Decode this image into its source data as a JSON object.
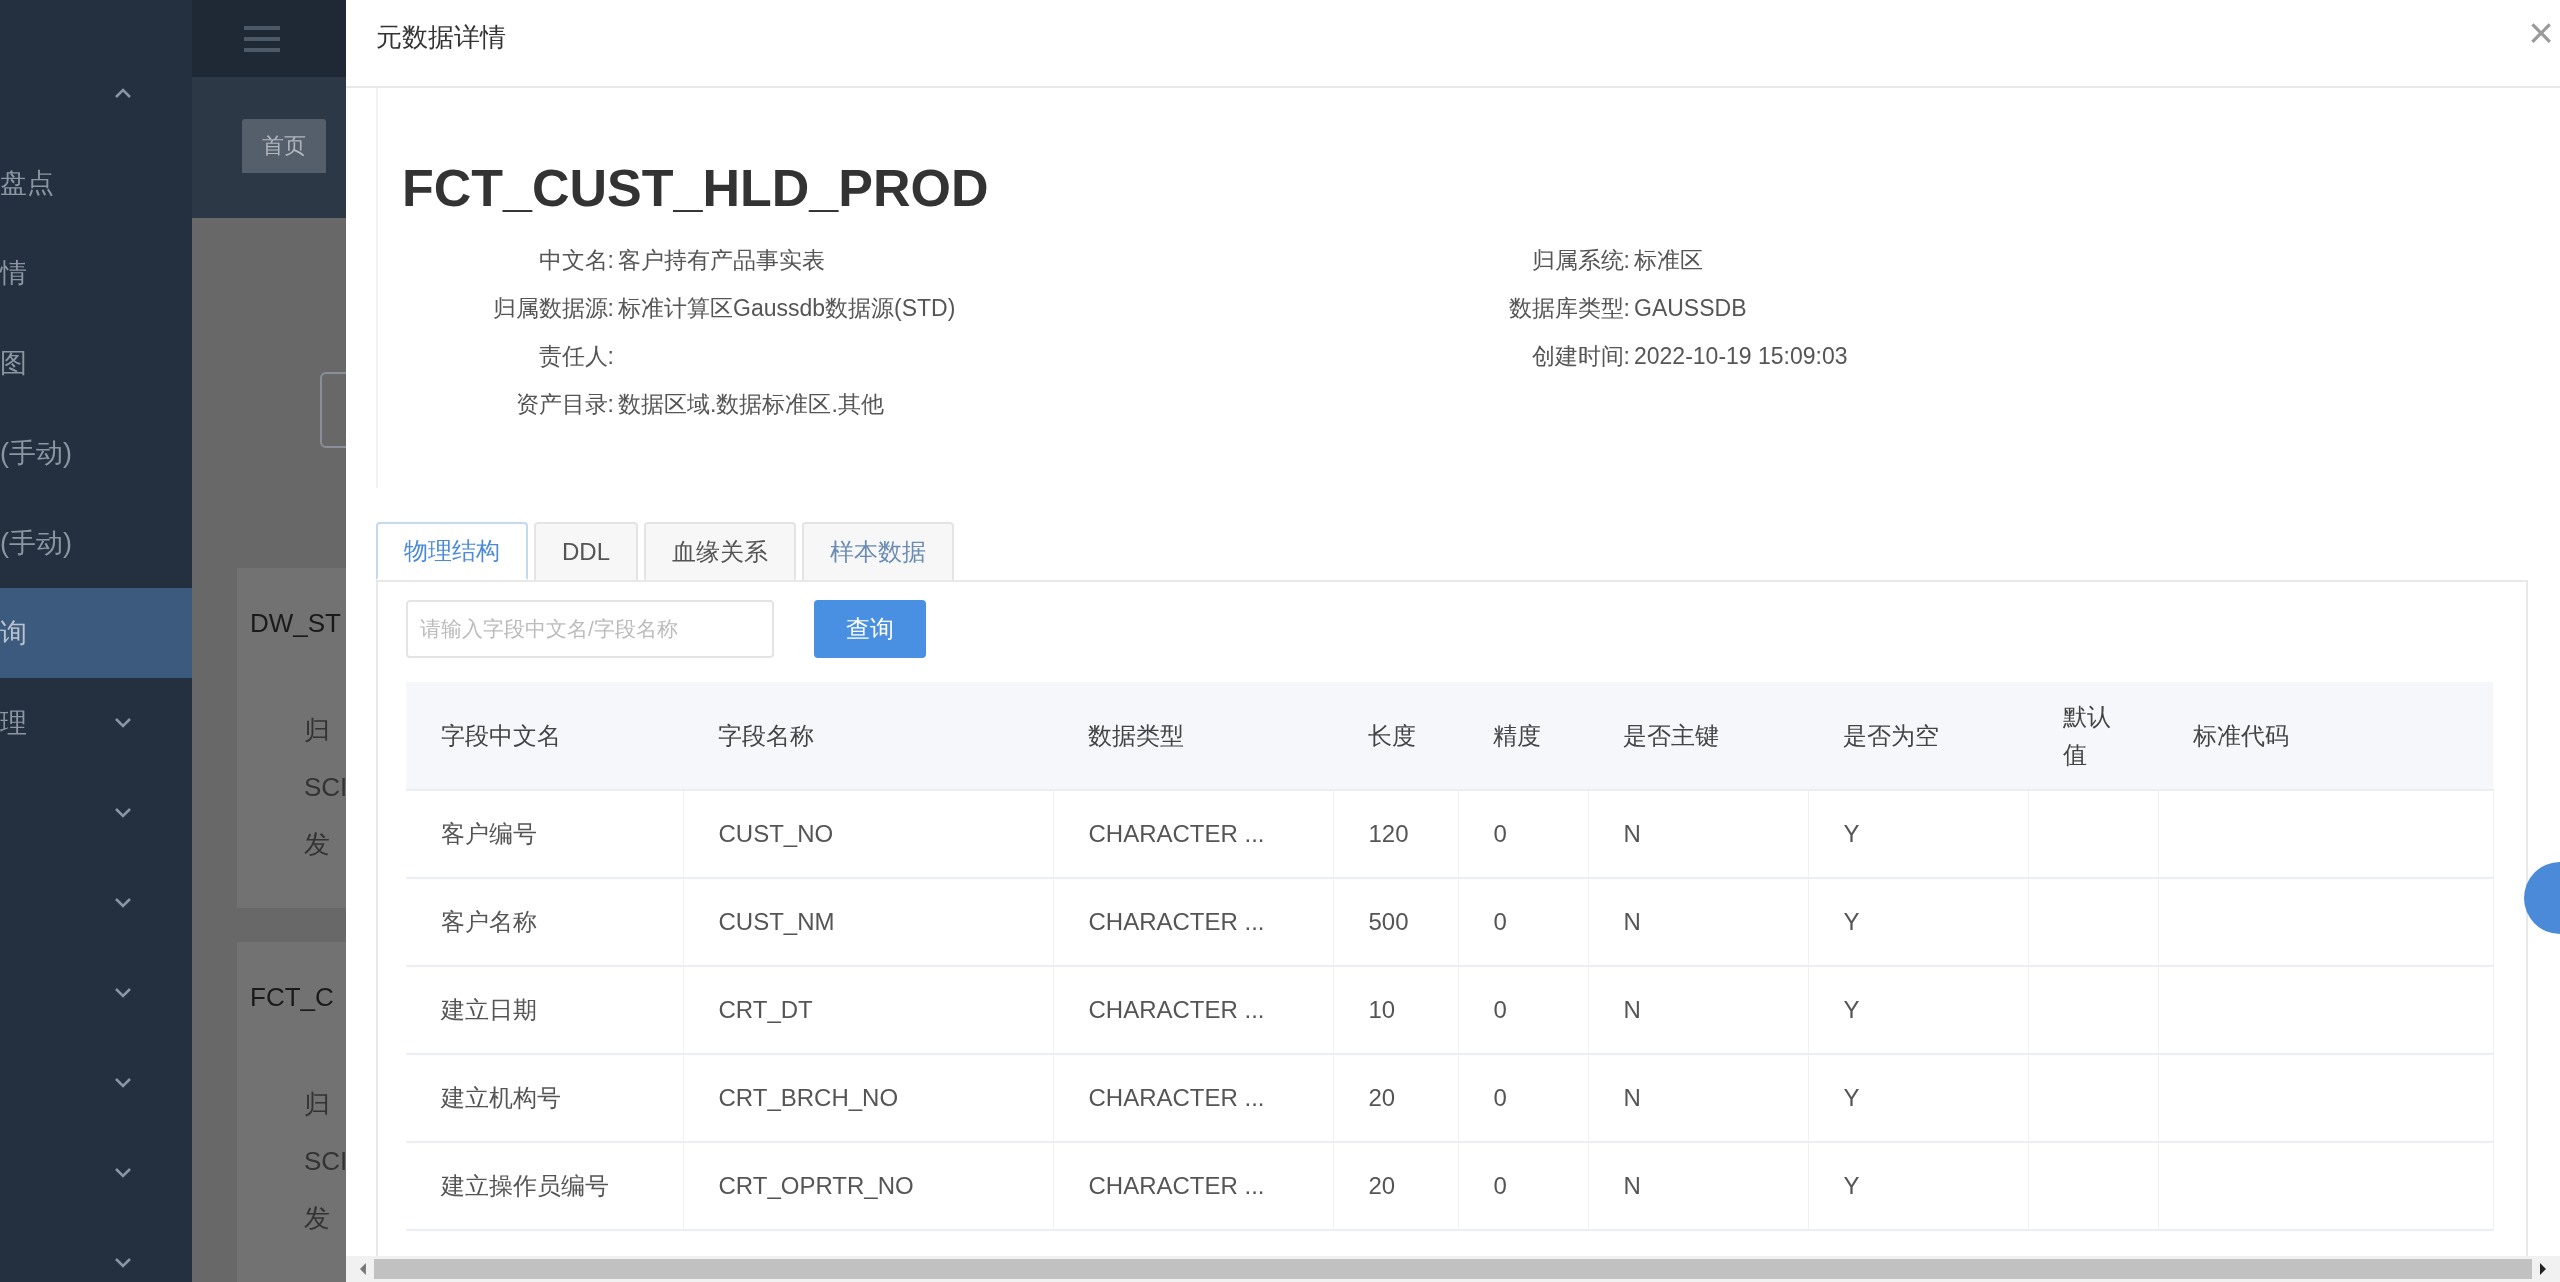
{
  "background": {
    "sidebar": {
      "items": [
        {
          "kind": "collapse",
          "selected": false
        },
        {
          "label": "盘点",
          "kind": "item",
          "selected": false
        },
        {
          "label": "情",
          "kind": "item",
          "selected": false
        },
        {
          "label": "图",
          "kind": "item",
          "selected": false
        },
        {
          "label": "(手动)",
          "kind": "item",
          "selected": false
        },
        {
          "label": "(手动)",
          "kind": "item",
          "selected": false
        },
        {
          "label": "询",
          "kind": "item",
          "selected": true
        },
        {
          "label": "理",
          "kind": "group",
          "selected": false
        },
        {
          "kind": "group",
          "selected": false
        },
        {
          "kind": "group",
          "selected": false
        },
        {
          "kind": "group",
          "selected": false
        },
        {
          "kind": "group",
          "selected": false
        },
        {
          "kind": "group",
          "selected": false
        },
        {
          "kind": "group",
          "selected": false
        }
      ]
    },
    "tabs": [
      {
        "label": "首页",
        "selected": true
      }
    ],
    "cards": [
      {
        "title": "DW_ST",
        "lines": [
          "归",
          "SCI",
          "发"
        ]
      },
      {
        "title": "FCT_C",
        "lines": [
          "归",
          "SCI",
          "发"
        ]
      }
    ]
  },
  "drawer": {
    "title": "元数据详情",
    "close": "×",
    "table_name": "FCT_CUST_HLD_PROD",
    "info_left": [
      {
        "label": "中文名:",
        "value": "客户持有产品事实表"
      },
      {
        "label": "归属数据源:",
        "value": "标准计算区Gaussdb数据源(STD)"
      },
      {
        "label": "责任人:"
      },
      {
        "label": "资产目录:",
        "value": "数据区域.数据标准区.其他"
      }
    ],
    "info_right": [
      {
        "label": "归属系统:",
        "value": "标准区"
      },
      {
        "label": "数据库类型:",
        "value": "GAUSSDB"
      },
      {
        "label": "创建时间:",
        "value": "2022-10-19 15:09:03"
      }
    ],
    "tabs": [
      {
        "label": "物理结构",
        "selected": true
      },
      {
        "label": "DDL",
        "selected": false
      },
      {
        "label": "血缘关系",
        "selected": false
      },
      {
        "label": "样本数据",
        "selected": false
      }
    ],
    "search": {
      "placeholder": "请输入字段中文名/字段名称"
    },
    "query_button": "查询",
    "table": {
      "columns": [
        "字段中文名",
        "字段名称",
        "数据类型",
        "长度",
        "精度",
        "是否主键",
        "是否为空",
        "默认值",
        "标准代码"
      ],
      "rows": [
        [
          "客户编号",
          "CUST_NO",
          "CHARACTER ...",
          "120",
          "0",
          "N",
          "Y",
          "",
          ""
        ],
        [
          "客户名称",
          "CUST_NM",
          "CHARACTER ...",
          "500",
          "0",
          "N",
          "Y",
          "",
          ""
        ],
        [
          "建立日期",
          "CRT_DT",
          "CHARACTER ...",
          "10",
          "0",
          "N",
          "Y",
          "",
          ""
        ],
        [
          "建立机构号",
          "CRT_BRCH_NO",
          "CHARACTER ...",
          "20",
          "0",
          "N",
          "Y",
          "",
          ""
        ],
        [
          "建立操作员编号",
          "CRT_OPRTR_NO",
          "CHARACTER ...",
          "20",
          "0",
          "N",
          "Y",
          "",
          ""
        ]
      ]
    }
  }
}
